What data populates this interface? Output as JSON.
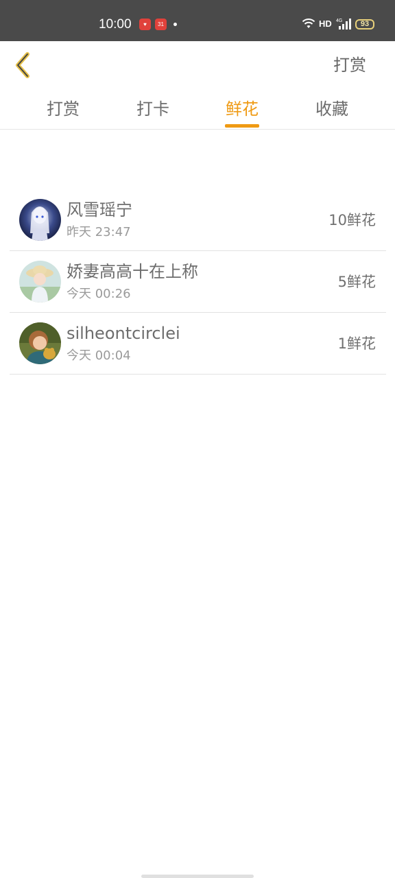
{
  "status_bar": {
    "time": "10:00",
    "app_icon_2_label": "31",
    "network_label": "HD",
    "signal_label": "4G",
    "battery_level": "93"
  },
  "header": {
    "back_icon": "chevron-left-icon",
    "action_label": "打赏"
  },
  "tabs": [
    {
      "label": "打赏",
      "active": false
    },
    {
      "label": "打卡",
      "active": false
    },
    {
      "label": "鲜花",
      "active": true
    },
    {
      "label": "收藏",
      "active": false
    }
  ],
  "colors": {
    "accent": "#ef9a13",
    "status_bar": "#4a4a4a"
  },
  "list": [
    {
      "name": "风雪瑶宁",
      "time": "昨天 23:47",
      "flowers": "10鲜花"
    },
    {
      "name": "娇妻高高十在上称",
      "time": "今天 00:26",
      "flowers": "5鲜花"
    },
    {
      "name": "silheontcirclei",
      "time": "今天 00:04",
      "flowers": "1鲜花"
    }
  ]
}
